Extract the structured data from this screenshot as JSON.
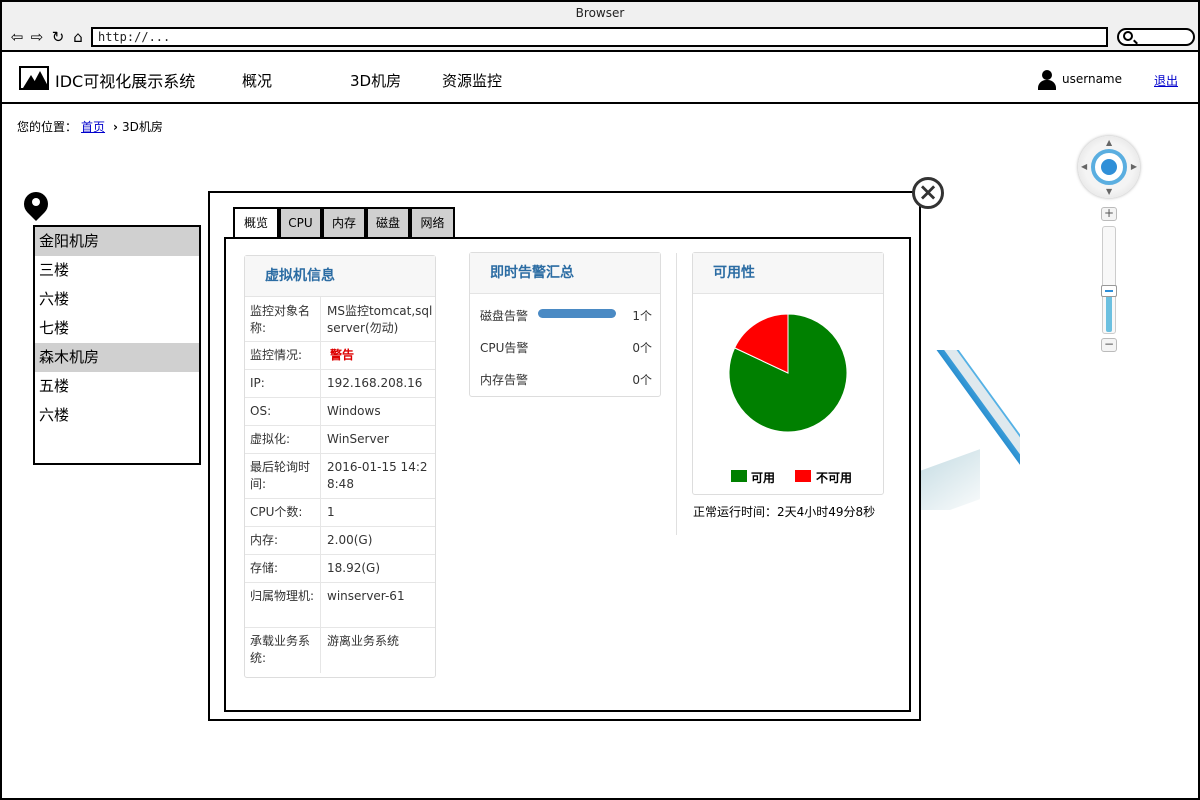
{
  "browser": {
    "title": "Browser",
    "url": "http://..."
  },
  "app": {
    "title": "IDC可视化展示系统",
    "nav": [
      "概况",
      "3D机房",
      "资源监控"
    ],
    "username": "username",
    "logout": "退出"
  },
  "breadcrumb": {
    "prefix": "您的位置：",
    "home": "首页",
    "current": "3D机房"
  },
  "rooms": [
    {
      "label": "金阳机房",
      "group": true
    },
    {
      "label": "三楼",
      "group": false
    },
    {
      "label": "六楼",
      "group": false
    },
    {
      "label": "七楼",
      "group": false
    },
    {
      "label": "森木机房",
      "group": true
    },
    {
      "label": "五楼",
      "group": false
    },
    {
      "label": "六楼",
      "group": false
    }
  ],
  "tabs": [
    "概览",
    "CPU",
    "内存",
    "磁盘",
    "网络"
  ],
  "vm": {
    "title": "虚拟机信息",
    "rows": [
      {
        "k": "监控对象名称:",
        "v": "MS监控tomcat,sqlserver(勿动)"
      },
      {
        "k": "监控情况:",
        "v": "警告"
      },
      {
        "k": "IP:",
        "v": "192.168.208.16"
      },
      {
        "k": "OS:",
        "v": "Windows"
      },
      {
        "k": "虚拟化:",
        "v": "WinServer"
      },
      {
        "k": "最后轮询时间:",
        "v": "2016-01-15 14:28:48"
      },
      {
        "k": "CPU个数:",
        "v": "1"
      },
      {
        "k": "内存:",
        "v": "2.00(G)"
      },
      {
        "k": "存储:",
        "v": "18.92(G)"
      },
      {
        "k": "归属物理机:",
        "v": "winserver-61"
      },
      {
        "k": "承载业务系统:",
        "v": "游离业务系统"
      }
    ]
  },
  "alerts": {
    "title": "即时告警汇总",
    "items": [
      {
        "label": "磁盘告警",
        "count": "1个",
        "has_bar": true
      },
      {
        "label": "CPU告警",
        "count": "0个",
        "has_bar": false
      },
      {
        "label": "内存告警",
        "count": "0个",
        "has_bar": false
      }
    ]
  },
  "availability": {
    "title": "可用性",
    "legend": [
      {
        "label": "可用",
        "color": "#008000"
      },
      {
        "label": "不可用",
        "color": "#ff0000"
      }
    ],
    "uptime": "正常运行时间：2天4小时49分8秒"
  },
  "chart_data": {
    "type": "pie",
    "labels": [
      "可用",
      "不可用"
    ],
    "values": [
      82,
      18
    ],
    "colors": [
      "#008000",
      "#ff0000"
    ]
  }
}
